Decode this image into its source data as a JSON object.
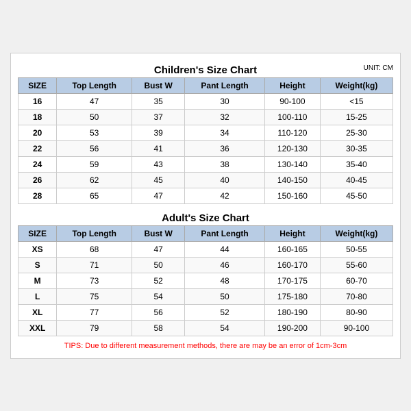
{
  "children_title": "Children's Size Chart",
  "adults_title": "Adult's Size Chart",
  "unit": "UNIT: CM",
  "headers": [
    "SIZE",
    "Top Length",
    "Bust W",
    "Pant Length",
    "Height",
    "Weight(kg)"
  ],
  "children_rows": [
    [
      "16",
      "47",
      "35",
      "30",
      "90-100",
      "<15"
    ],
    [
      "18",
      "50",
      "37",
      "32",
      "100-110",
      "15-25"
    ],
    [
      "20",
      "53",
      "39",
      "34",
      "110-120",
      "25-30"
    ],
    [
      "22",
      "56",
      "41",
      "36",
      "120-130",
      "30-35"
    ],
    [
      "24",
      "59",
      "43",
      "38",
      "130-140",
      "35-40"
    ],
    [
      "26",
      "62",
      "45",
      "40",
      "140-150",
      "40-45"
    ],
    [
      "28",
      "65",
      "47",
      "42",
      "150-160",
      "45-50"
    ]
  ],
  "adult_rows": [
    [
      "XS",
      "68",
      "47",
      "44",
      "160-165",
      "50-55"
    ],
    [
      "S",
      "71",
      "50",
      "46",
      "160-170",
      "55-60"
    ],
    [
      "M",
      "73",
      "52",
      "48",
      "170-175",
      "60-70"
    ],
    [
      "L",
      "75",
      "54",
      "50",
      "175-180",
      "70-80"
    ],
    [
      "XL",
      "77",
      "56",
      "52",
      "180-190",
      "80-90"
    ],
    [
      "XXL",
      "79",
      "58",
      "54",
      "190-200",
      "90-100"
    ]
  ],
  "tips": "TIPS: Due to different measurement methods, there are may be an error of 1cm-3cm"
}
